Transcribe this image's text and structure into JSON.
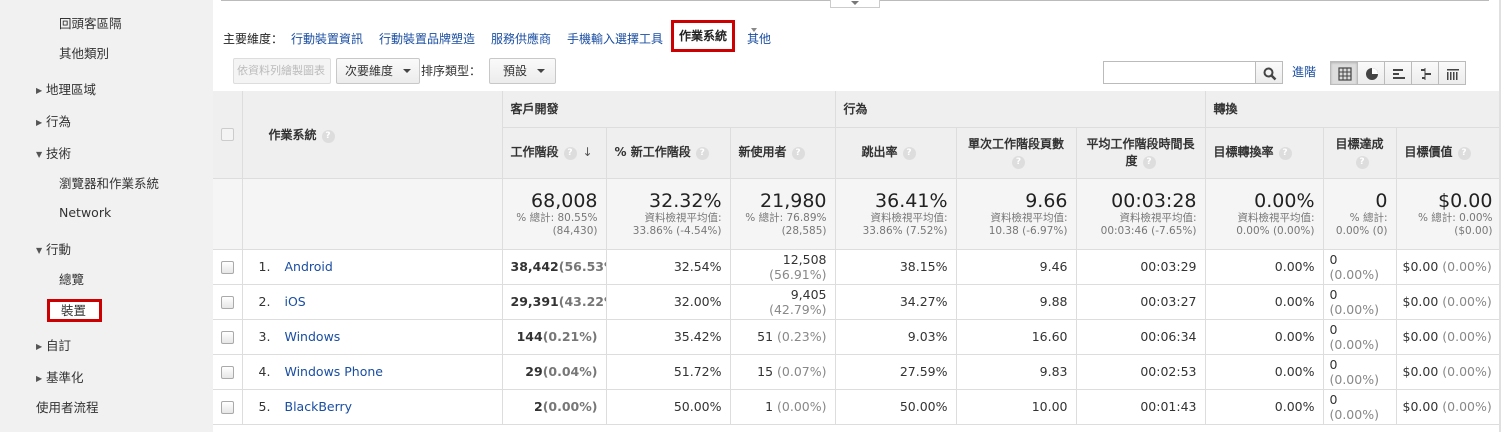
{
  "sidebar": {
    "items": [
      {
        "label": "回頭客區隔",
        "level": "sub",
        "expanded": null
      },
      {
        "label": "其他類別",
        "level": "sub",
        "expanded": null
      },
      {
        "label": "地理區域",
        "level": "top",
        "expanded": false
      },
      {
        "label": "行為",
        "level": "top",
        "expanded": false
      },
      {
        "label": "技術",
        "level": "top",
        "expanded": true
      },
      {
        "label": "瀏覽器和作業系統",
        "level": "sub",
        "expanded": null
      },
      {
        "label": "Network",
        "level": "sub",
        "expanded": null
      },
      {
        "label": "行動",
        "level": "top",
        "expanded": true
      },
      {
        "label": "總覽",
        "level": "sub",
        "expanded": null
      },
      {
        "label": "裝置",
        "level": "sub",
        "expanded": null,
        "selected": true
      },
      {
        "label": "自訂",
        "level": "top",
        "expanded": false
      },
      {
        "label": "基準化",
        "level": "top",
        "expanded": false
      },
      {
        "label": "使用者流程",
        "level": "top",
        "expanded": null
      }
    ]
  },
  "dimensions": {
    "label": "主要維度：",
    "links": [
      "行動裝置資訊",
      "行動裝置品牌塑造",
      "服務供應商",
      "手機輸入選擇工具"
    ],
    "active": "作業系統",
    "more": "其他"
  },
  "toolbar": {
    "plot_rows": "依資料列繪製圖表",
    "secondary_dimension": "次要維度",
    "sort_type_label": "排序類型：",
    "sort_type_value": "預設",
    "search_placeholder": "",
    "advanced": "進階",
    "views": [
      "table-icon",
      "pie-icon",
      "bar-icon",
      "comparison-icon",
      "pivot-icon"
    ]
  },
  "table": {
    "dimension_header": "作業系統",
    "groups": [
      {
        "label": "客戶開發",
        "span": 3
      },
      {
        "label": "行為",
        "span": 4
      },
      {
        "label": "轉換",
        "span": 3
      }
    ],
    "metrics": [
      "工作階段",
      "% 新工作階段",
      "新使用者",
      "跳出率",
      "單次工作階段頁數",
      "平均工作階段時間長度",
      "目標轉換率",
      "目標達成",
      "目標價值"
    ],
    "totals": [
      {
        "value": "68,008",
        "sub1": "% 總計: 80.55%",
        "sub2": "(84,430)"
      },
      {
        "value": "32.32%",
        "sub1": "資料檢視平均值:",
        "sub2": "33.86% (-4.54%)"
      },
      {
        "value": "21,980",
        "sub1": "% 總計: 76.89%",
        "sub2": "(28,585)"
      },
      {
        "value": "36.41%",
        "sub1": "資料檢視平均值:",
        "sub2": "33.86% (7.52%)"
      },
      {
        "value": "9.66",
        "sub1": "資料檢視平均值:",
        "sub2": "10.38 (-6.97%)"
      },
      {
        "value": "00:03:28",
        "sub1": "資料檢視平均值:",
        "sub2": "00:03:46 (-7.65%)"
      },
      {
        "value": "0.00%",
        "sub1": "資料檢視平均值:",
        "sub2": "0.00% (0.00%)"
      },
      {
        "value": "0",
        "sub1": "% 總計:",
        "sub2": "0.00% (0)"
      },
      {
        "value": "$0.00",
        "sub1": "% 總計: 0.00%",
        "sub2": "($0.00)"
      }
    ],
    "rows": [
      {
        "rank": "1.",
        "os": "Android",
        "sessions": "38,442",
        "sessions_pct": "(56.53%)",
        "new_pct": "32.54%",
        "new_users": "12,508",
        "new_users_pct": "(56.91%)",
        "bounce": "38.15%",
        "pages": "9.46",
        "duration": "00:03:29",
        "conv_rate": "0.00%",
        "goal": "0",
        "goal_pct": "(0.00%)",
        "value": "$0.00",
        "value_pct": "(0.00%)"
      },
      {
        "rank": "2.",
        "os": "iOS",
        "sessions": "29,391",
        "sessions_pct": "(43.22%)",
        "new_pct": "32.00%",
        "new_users": "9,405",
        "new_users_pct": "(42.79%)",
        "bounce": "34.27%",
        "pages": "9.88",
        "duration": "00:03:27",
        "conv_rate": "0.00%",
        "goal": "0",
        "goal_pct": "(0.00%)",
        "value": "$0.00",
        "value_pct": "(0.00%)"
      },
      {
        "rank": "3.",
        "os": "Windows",
        "sessions": "144",
        "sessions_pct": "(0.21%)",
        "new_pct": "35.42%",
        "new_users": "51",
        "new_users_pct": "(0.23%)",
        "bounce": "9.03%",
        "pages": "16.60",
        "duration": "00:06:34",
        "conv_rate": "0.00%",
        "goal": "0",
        "goal_pct": "(0.00%)",
        "value": "$0.00",
        "value_pct": "(0.00%)"
      },
      {
        "rank": "4.",
        "os": "Windows Phone",
        "sessions": "29",
        "sessions_pct": "(0.04%)",
        "new_pct": "51.72%",
        "new_users": "15",
        "new_users_pct": "(0.07%)",
        "bounce": "27.59%",
        "pages": "9.83",
        "duration": "00:02:53",
        "conv_rate": "0.00%",
        "goal": "0",
        "goal_pct": "(0.00%)",
        "value": "$0.00",
        "value_pct": "(0.00%)"
      },
      {
        "rank": "5.",
        "os": "BlackBerry",
        "sessions": "2",
        "sessions_pct": "(0.00%)",
        "new_pct": "50.00%",
        "new_users": "1",
        "new_users_pct": "(0.00%)",
        "bounce": "50.00%",
        "pages": "10.00",
        "duration": "00:01:43",
        "conv_rate": "0.00%",
        "goal": "0",
        "goal_pct": "(0.00%)",
        "value": "$0.00",
        "value_pct": "(0.00%)"
      }
    ]
  },
  "colors": {
    "link": "#1a4ea2",
    "highlight": "#cc0000",
    "sidebar_bg": "#f1f1f1",
    "header_bg": "#efefef"
  }
}
